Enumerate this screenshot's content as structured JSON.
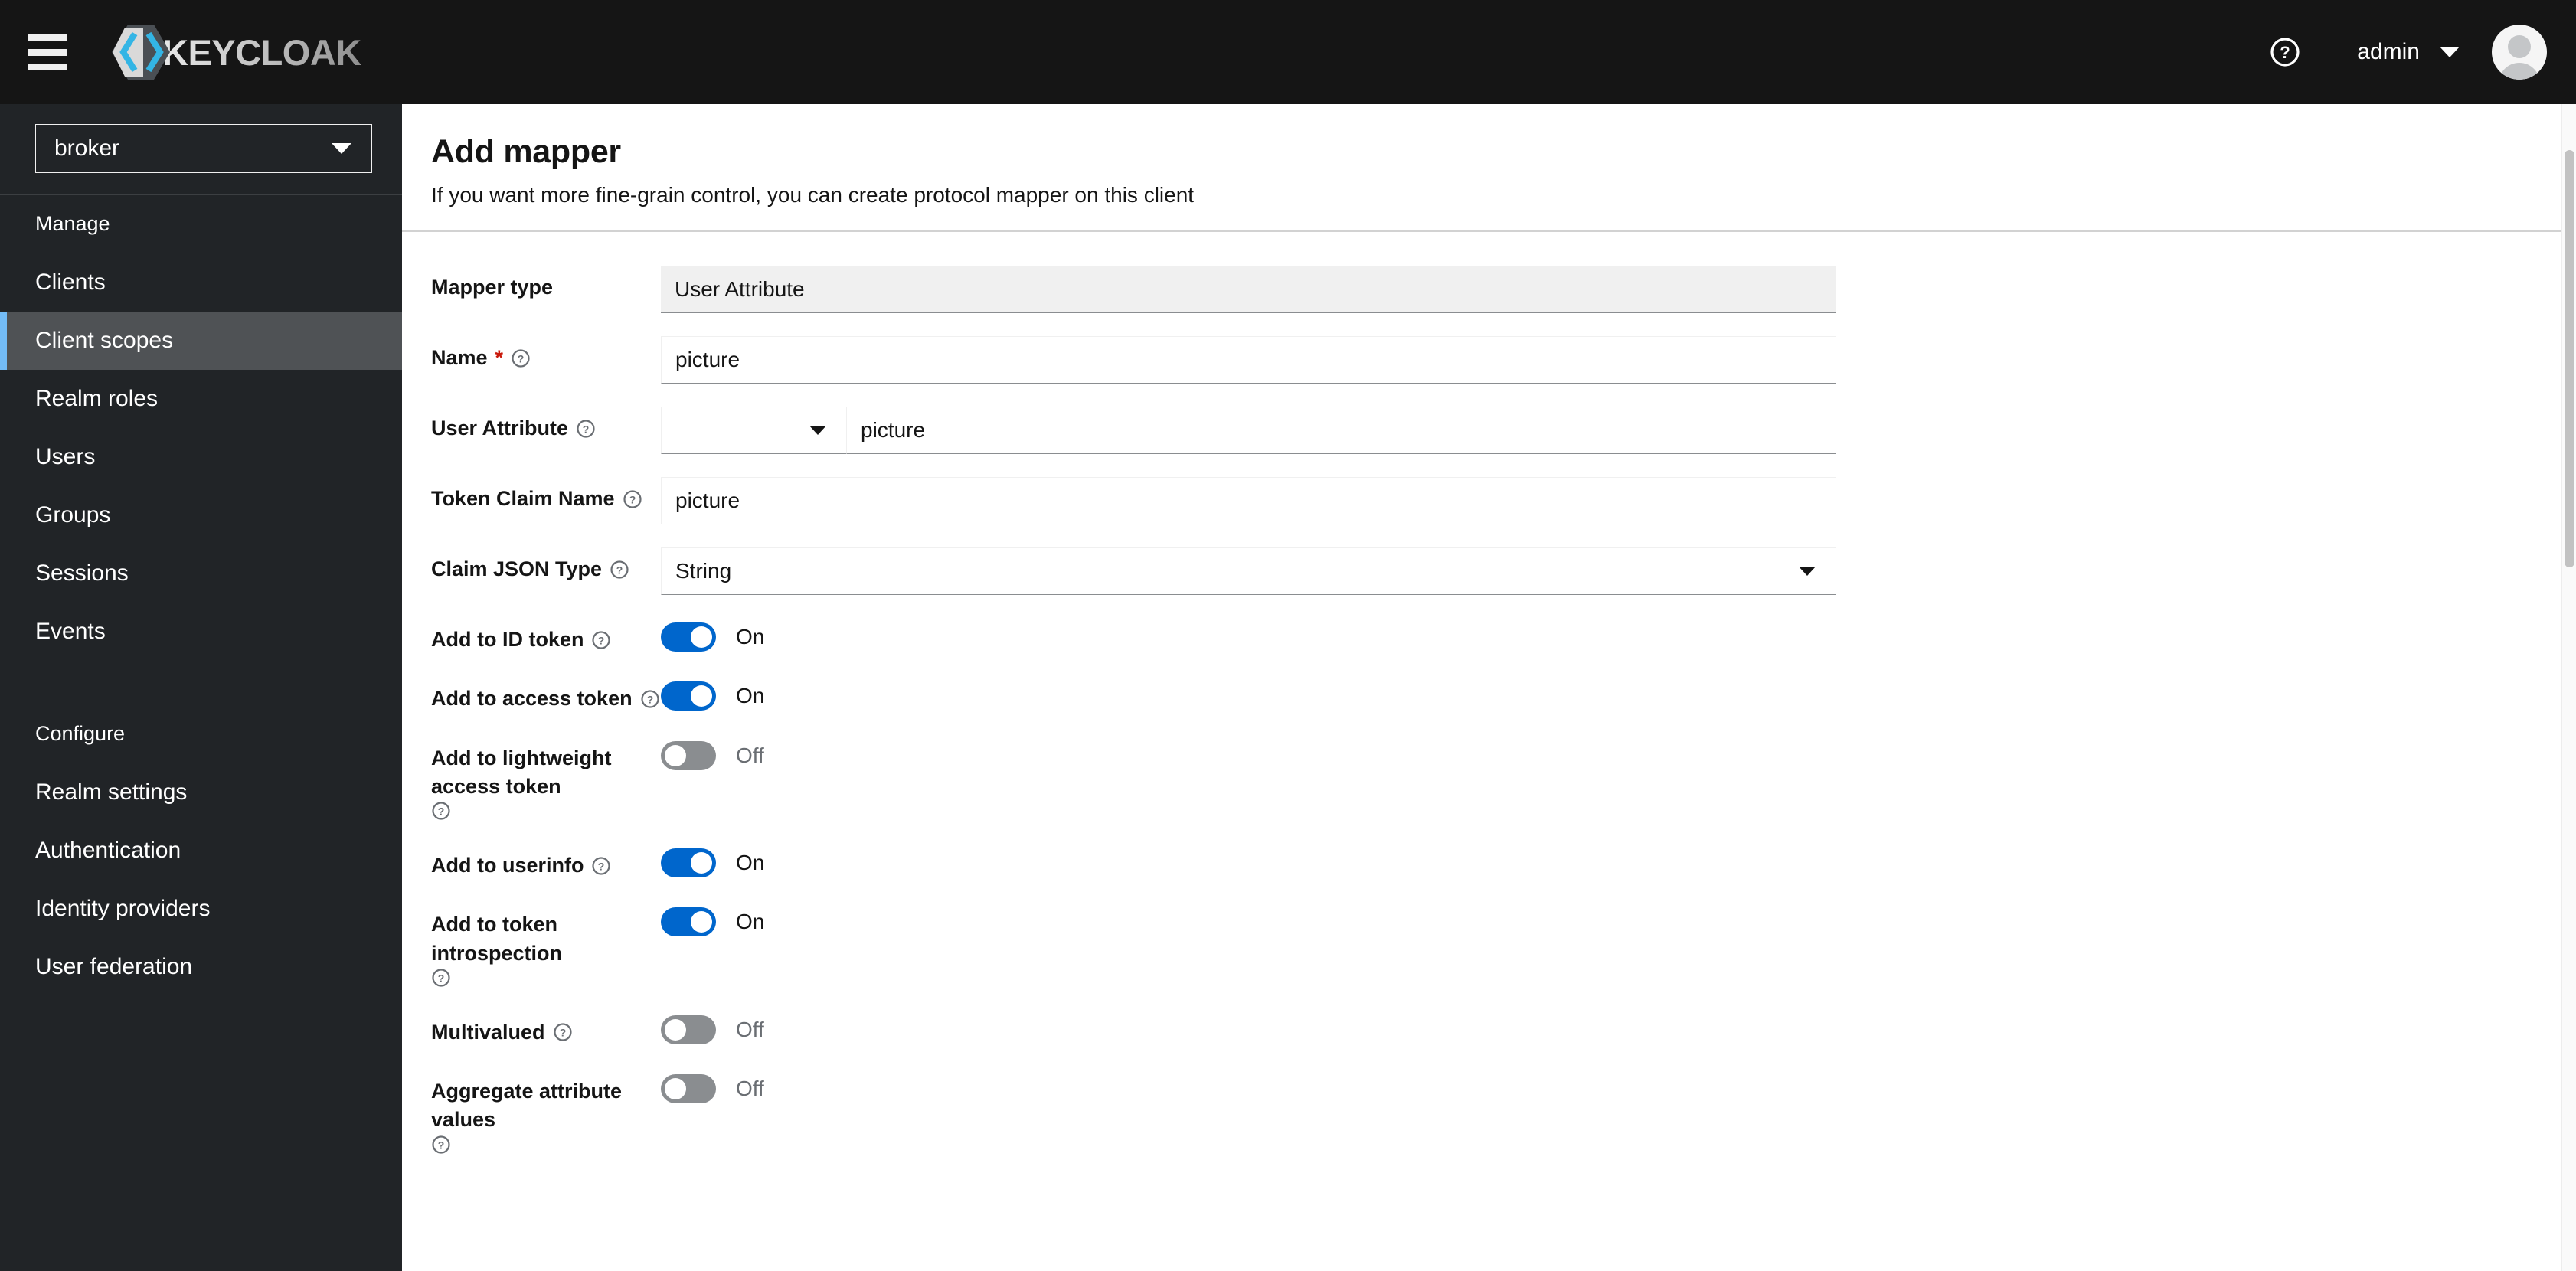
{
  "masthead": {
    "menu_toggle": "hamburger-menu",
    "brand_name": "KEYCLOAK",
    "help_label": "?",
    "user_name": "admin"
  },
  "sidebar": {
    "realm": {
      "selected": "broker"
    },
    "groups": [
      {
        "title": "Manage",
        "items": [
          {
            "label": "Clients",
            "active": false
          },
          {
            "label": "Client scopes",
            "active": true
          },
          {
            "label": "Realm roles",
            "active": false
          },
          {
            "label": "Users",
            "active": false
          },
          {
            "label": "Groups",
            "active": false
          },
          {
            "label": "Sessions",
            "active": false
          },
          {
            "label": "Events",
            "active": false
          }
        ]
      },
      {
        "title": "Configure",
        "items": [
          {
            "label": "Realm settings",
            "active": false
          },
          {
            "label": "Authentication",
            "active": false
          },
          {
            "label": "Identity providers",
            "active": false
          },
          {
            "label": "User federation",
            "active": false
          }
        ]
      }
    ]
  },
  "page": {
    "title": "Add mapper",
    "subtitle": "If you want more fine-grain control, you can create protocol mapper on this client"
  },
  "form": {
    "mapper_type": {
      "label": "Mapper type",
      "value": "User Attribute"
    },
    "name": {
      "label": "Name",
      "required_marker": "*",
      "value": "picture"
    },
    "user_attribute": {
      "label": "User Attribute",
      "select_value": "",
      "value": "picture"
    },
    "token_claim_name": {
      "label": "Token Claim Name",
      "value": "picture"
    },
    "claim_json_type": {
      "label": "Claim JSON Type",
      "value": "String"
    },
    "toggles": [
      {
        "label": "Add to ID token",
        "state": "On",
        "on": true
      },
      {
        "label": "Add to access token",
        "state": "On",
        "on": true
      },
      {
        "label": "Add to lightweight access token",
        "state": "Off",
        "on": false
      },
      {
        "label": "Add to userinfo",
        "state": "On",
        "on": true
      },
      {
        "label": "Add to token introspection",
        "state": "On",
        "on": true
      },
      {
        "label": "Multivalued",
        "state": "Off",
        "on": false
      },
      {
        "label": "Aggregate attribute values",
        "state": "Off",
        "on": false
      }
    ]
  },
  "colors": {
    "masthead_bg": "#151515",
    "sidebar_bg": "#212427",
    "active_accent": "#73bcf7",
    "active_bg": "#4f5255",
    "toggle_on": "#0066cc",
    "toggle_off": "#8a8d90",
    "required": "#c9190b"
  }
}
